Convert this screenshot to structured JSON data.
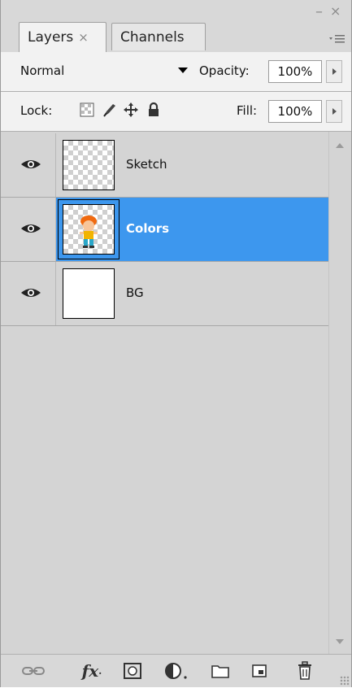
{
  "window": {
    "controls": {
      "minimize": "–",
      "close": "×"
    }
  },
  "tabs": [
    {
      "label": "Layers",
      "close": "×",
      "active": true
    },
    {
      "label": "Channels",
      "active": false
    }
  ],
  "tab_menu_icon": "panel-menu-icon",
  "blend": {
    "mode": "Normal"
  },
  "opacity": {
    "label": "Opacity:",
    "value": "100%"
  },
  "lock": {
    "label": "Lock:",
    "icons": [
      "lock-transparent-pixels-icon",
      "lock-image-pixels-icon",
      "lock-position-icon",
      "lock-all-icon"
    ]
  },
  "fill": {
    "label": "Fill:",
    "value": "100%"
  },
  "layers": [
    {
      "name": "Sketch",
      "visible": true,
      "selected": false,
      "thumb": "transparent"
    },
    {
      "name": "Colors",
      "visible": true,
      "selected": true,
      "thumb": "character"
    },
    {
      "name": "BG",
      "visible": true,
      "selected": false,
      "thumb": "white"
    }
  ],
  "footer_icons": [
    "link-layers-icon",
    "fx-icon",
    "add-mask-icon",
    "adjustment-layer-icon",
    "new-group-icon",
    "new-layer-icon",
    "delete-layer-icon"
  ],
  "footer": {
    "fx_label": "fx"
  },
  "colors": {
    "selection": "#3d97ee",
    "panel_bg": "#d4d4d4"
  }
}
